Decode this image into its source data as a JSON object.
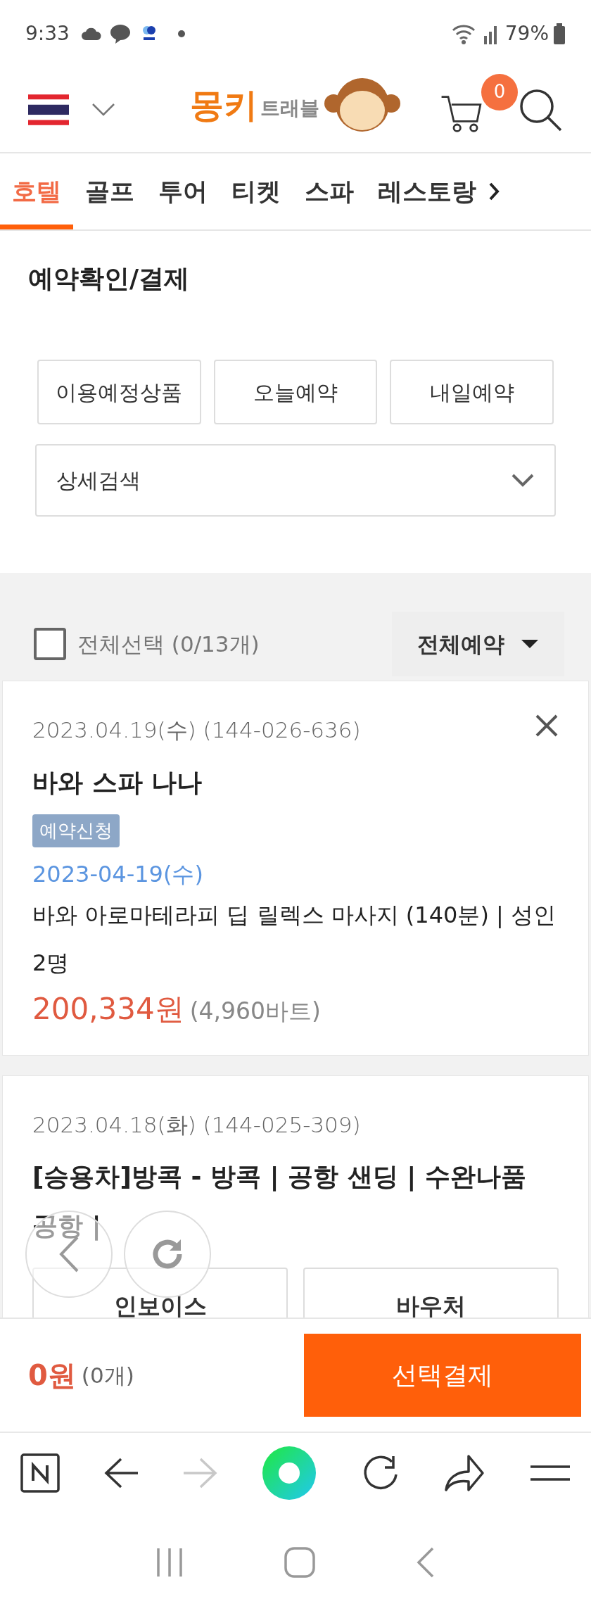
{
  "status_bar": {
    "time": "9:33",
    "battery": "79%"
  },
  "header": {
    "logo": {
      "primary": "몽키",
      "secondary": "트래블"
    },
    "cart_count": "0"
  },
  "tabs": [
    {
      "label": "호텔",
      "selected": true
    },
    {
      "label": "골프",
      "selected": false
    },
    {
      "label": "투어",
      "selected": false
    },
    {
      "label": "티켓",
      "selected": false
    },
    {
      "label": "스파",
      "selected": false
    },
    {
      "label": "레스토랑",
      "selected": false
    }
  ],
  "page_title": "예약확인/결제",
  "quick_filters": [
    "이용예정상품",
    "오늘예약",
    "내일예약"
  ],
  "detail_search": {
    "label": "상세검색"
  },
  "select_all": {
    "label": "전체선택 (0/13개)",
    "checked": false
  },
  "status_filter": {
    "label": "전체예약"
  },
  "bookings": [
    {
      "header": "2023.04.19(수) (144-026-636)",
      "title": "바와 스파 나나",
      "removable": true,
      "status": "예약신청",
      "use_date": "2023-04-19(수)",
      "option": "바와 아로마테라피 딥 릴렉스 마사지 (140분) | 성인 2명",
      "price": "200,334원",
      "local_price": "(4,960바트)"
    },
    {
      "header": "2023.04.18(화) (144-025-309)",
      "title": "[승용차]방콕 - 방콕 | 공항 샌딩 | 수완나품 공항 |",
      "removable": false,
      "actions": [
        "인보이스",
        "바우처"
      ]
    }
  ],
  "footer": {
    "total": "0원",
    "count": "(0개)",
    "pay_button": "선택결제"
  },
  "browser": {
    "forward_enabled": false
  }
}
